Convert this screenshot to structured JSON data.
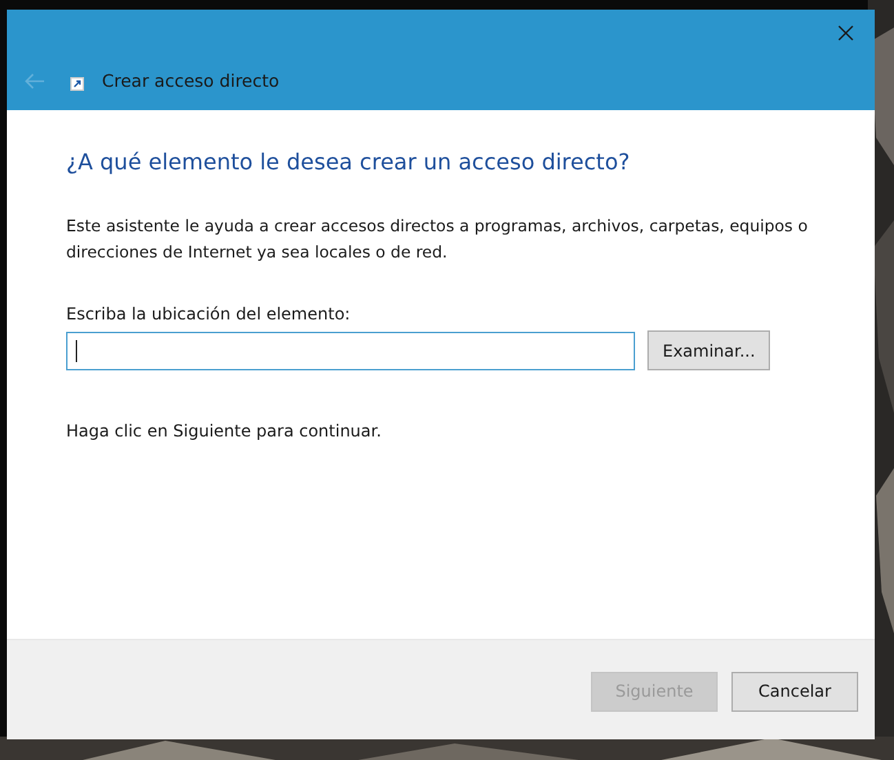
{
  "window": {
    "title": "Crear acceso directo",
    "back_disabled": true
  },
  "heading": "¿A qué elemento le desea crear un acceso directo?",
  "description": "Este asistente le ayuda a crear accesos directos a programas, archivos, carpetas, equipos o direcciones de Internet ya sea locales o de red.",
  "location": {
    "label": "Escriba la ubicación del elemento:",
    "focused": true,
    "browse_button": "Examinar..."
  },
  "hint": "Haga clic en Siguiente para continuar.",
  "buttons": [
    {
      "label": "Siguiente",
      "disabled": true
    },
    {
      "label": "Cancelar",
      "disabled": false
    }
  ]
}
